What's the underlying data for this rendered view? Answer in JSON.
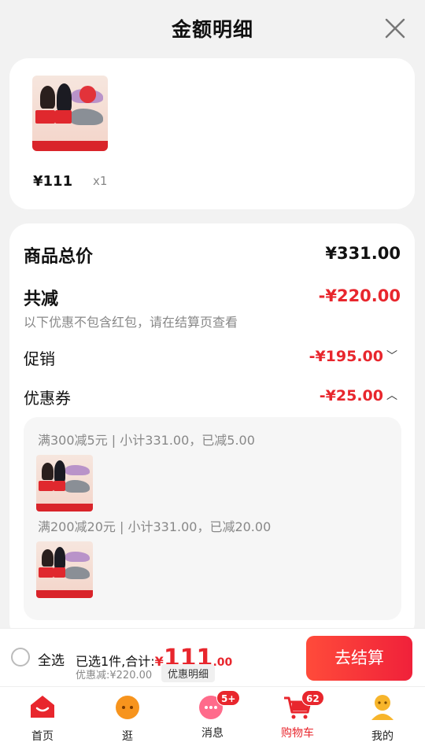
{
  "header": {
    "title": "金额明细"
  },
  "product": {
    "price": "¥111",
    "qty": "x1"
  },
  "summary": {
    "total_label": "商品总价",
    "total_value": "¥331.00",
    "reduce_label": "共减",
    "reduce_value": "-¥220.00",
    "reduce_note": "以下优惠不包含红包，请在结算页查看",
    "promo_label": "促销",
    "promo_value": "-¥195.00",
    "coupon_label": "优惠券",
    "coupon_value": "-¥25.00"
  },
  "coupons": [
    {
      "text": "满300减5元 | 小计331.00，已减5.00"
    },
    {
      "text": "满200减20元 | 小计331.00，已减20.00"
    }
  ],
  "bottom_bar": {
    "select_all": "全选",
    "selected_prefix": "已选1件,合计:",
    "currency": "¥",
    "amount_int": "111",
    "amount_dec": ".00",
    "discount_text": "优惠减:¥220.00",
    "detail_label": "优惠明细",
    "checkout_label": "去结算"
  },
  "tabbar": {
    "home": "首页",
    "browse": "逛",
    "messages": "消息",
    "messages_badge": "5+",
    "cart": "购物车",
    "cart_badge": "62",
    "mine": "我的"
  },
  "colors": {
    "accent": "#e8262d",
    "tab_home": "#e8262d",
    "tab_browse": "#f7941d",
    "tab_msg": "#ff6b8b",
    "tab_mine": "#f7b52b"
  }
}
